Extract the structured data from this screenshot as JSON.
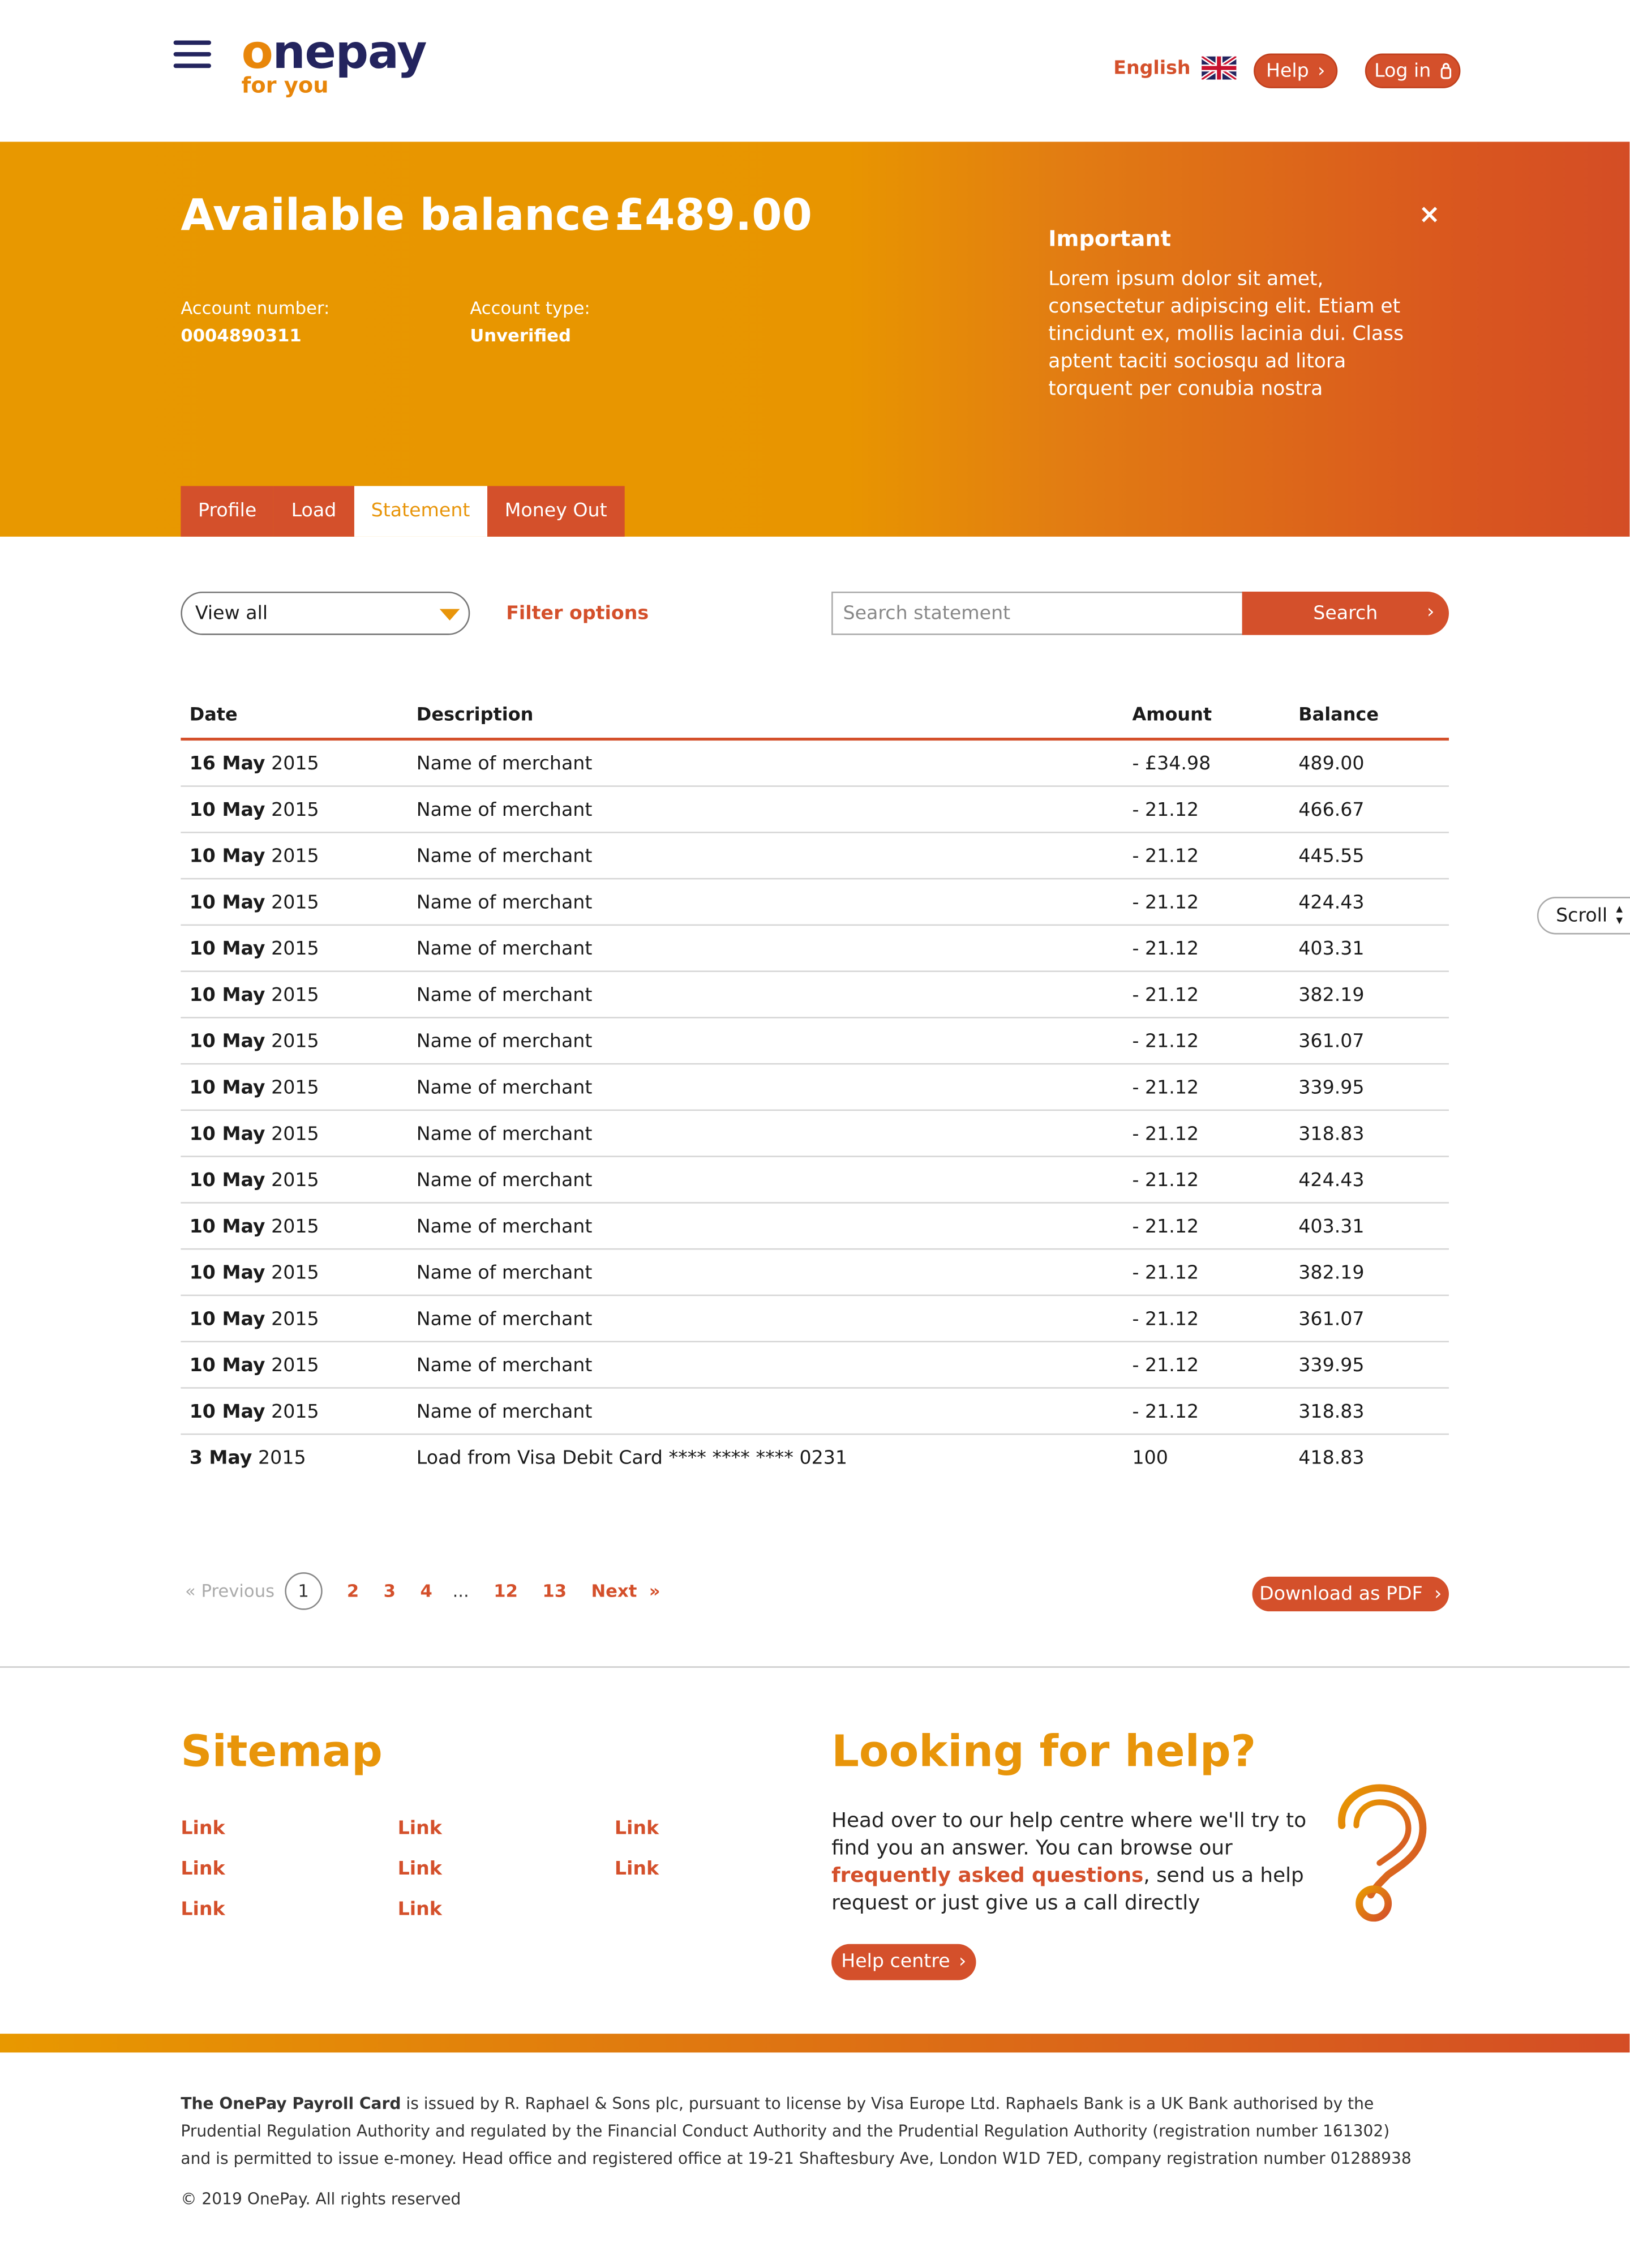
{
  "header": {
    "logo_text": "onepay",
    "logo_tagline": "for you",
    "language": "English",
    "help_label": "Help",
    "login_label": "Log in"
  },
  "hero": {
    "balance_label": "Available balance",
    "balance_value": "£489.00",
    "account_number_label": "Account number:",
    "account_number": "0004890311",
    "account_type_label": "Account type:",
    "account_type": "Unverified",
    "important_title": "Important",
    "important_body": "Lorem ipsum dolor sit amet, consectetur adipiscing elit. Etiam et tincidunt ex, mollis lacinia dui. Class aptent taciti sociosqu ad litora torquent per conubia nostra",
    "close": "×"
  },
  "tabs": [
    {
      "label": "Profile",
      "active": false
    },
    {
      "label": "Load",
      "active": false
    },
    {
      "label": "Statement",
      "active": true
    },
    {
      "label": "Money Out",
      "active": false
    }
  ],
  "controls": {
    "view_select": "View all",
    "filter_label": "Filter options",
    "search_placeholder": "Search statement",
    "search_button": "Search"
  },
  "table": {
    "headers": [
      "Date",
      "Description",
      "Amount",
      "Balance"
    ],
    "rows": [
      {
        "day": "16 May",
        "year": "2015",
        "description": "Name of merchant",
        "amount": "- £34.98",
        "balance": "489.00"
      },
      {
        "day": "10 May",
        "year": "2015",
        "description": "Name of merchant",
        "amount": "- 21.12",
        "balance": "466.67"
      },
      {
        "day": "10 May",
        "year": "2015",
        "description": "Name of merchant",
        "amount": "- 21.12",
        "balance": "445.55"
      },
      {
        "day": "10 May",
        "year": "2015",
        "description": "Name of merchant",
        "amount": "- 21.12",
        "balance": "424.43"
      },
      {
        "day": "10 May",
        "year": "2015",
        "description": "Name of merchant",
        "amount": "- 21.12",
        "balance": "403.31"
      },
      {
        "day": "10 May",
        "year": "2015",
        "description": "Name of merchant",
        "amount": "- 21.12",
        "balance": "382.19"
      },
      {
        "day": "10 May",
        "year": "2015",
        "description": "Name of merchant",
        "amount": "- 21.12",
        "balance": "361.07"
      },
      {
        "day": "10 May",
        "year": "2015",
        "description": "Name of merchant",
        "amount": "- 21.12",
        "balance": "339.95"
      },
      {
        "day": "10 May",
        "year": "2015",
        "description": "Name of merchant",
        "amount": "- 21.12",
        "balance": "318.83"
      },
      {
        "day": "10 May",
        "year": "2015",
        "description": "Name of merchant",
        "amount": "- 21.12",
        "balance": "424.43"
      },
      {
        "day": "10 May",
        "year": "2015",
        "description": "Name of merchant",
        "amount": "- 21.12",
        "balance": "403.31"
      },
      {
        "day": "10 May",
        "year": "2015",
        "description": "Name of merchant",
        "amount": "- 21.12",
        "balance": "382.19"
      },
      {
        "day": "10 May",
        "year": "2015",
        "description": "Name of merchant",
        "amount": "- 21.12",
        "balance": "361.07"
      },
      {
        "day": "10 May",
        "year": "2015",
        "description": "Name of merchant",
        "amount": "- 21.12",
        "balance": "339.95"
      },
      {
        "day": "10 May",
        "year": "2015",
        "description": "Name of merchant",
        "amount": "- 21.12",
        "balance": "318.83"
      },
      {
        "day": "3 May",
        "year": "2015",
        "description": "Load from Visa Debit Card **** **** **** 0231",
        "amount": "100",
        "balance": "418.83"
      }
    ]
  },
  "scroll_label": "Scroll",
  "pagination": {
    "previous": "Previous",
    "current": "1",
    "pages": [
      "2",
      "3",
      "4"
    ],
    "ellipsis": "...",
    "last_pages": [
      "12",
      "13"
    ],
    "next": "Next"
  },
  "download_pdf": "Download as PDF",
  "footer": {
    "sitemap_title": "Sitemap",
    "sitemap_links": [
      "Link",
      "Link",
      "Link",
      "Link",
      "Link",
      "Link",
      "Link",
      "Link"
    ],
    "help_title": "Looking for help?",
    "help_text_before": "Head over to our help centre where we'll try to find you an answer. You can browse our ",
    "help_text_link": "frequently asked questions",
    "help_text_after": ", send us a help request or just give us a call directly",
    "help_centre_button": "Help centre",
    "legal_bold": "The OnePay Payroll Card",
    "legal_text": " is issued by R. Raphael & Sons plc, pursuant to license by Visa Europe Ltd. Raphaels Bank is a UK Bank authorised by the Prudential Regulation Authority and regulated by the Financial Conduct Authority and the Prudential Regulation Authority (registration number 161302) and is permitted to issue e-money. Head office and registered office at 19-21 Shaftesbury Ave, London W1D 7ED, company registration number 01288938",
    "copyright": "© 2019 OnePay. All rights reserved"
  },
  "colors": {
    "brand_orange": "#e8950a",
    "brand_red": "#d4502b",
    "brand_navy": "#23245e"
  }
}
